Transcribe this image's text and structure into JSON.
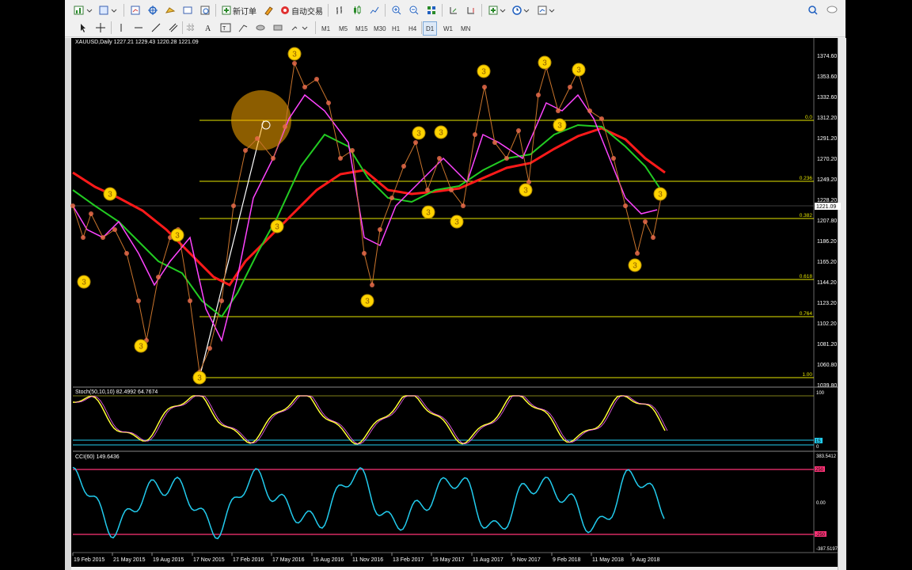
{
  "toolbar": {
    "new_order": "新订单",
    "auto_trading": "自动交易",
    "timeframes": [
      "M1",
      "M5",
      "M15",
      "M30",
      "H1",
      "H4",
      "D1",
      "W1",
      "MN"
    ],
    "active_timeframe": "D1"
  },
  "chart": {
    "symbol_info": "XAUUSD,Daily  1227.21 1229.43 1220.28 1221.09",
    "current_price": "1221.09",
    "price_ticks": [
      "1374.60",
      "1353.60",
      "1332.60",
      "1312.20",
      "1291.20",
      "1270.20",
      "1249.20",
      "1228.20",
      "1207.80",
      "1186.20",
      "1165.20",
      "1144.20",
      "1123.20",
      "1102.20",
      "1081.20",
      "1060.80",
      "1039.80"
    ],
    "fib_levels": [
      {
        "label": "0.0"
      },
      {
        "label": "0.236"
      },
      {
        "label": "0.382"
      },
      {
        "label": "0.618"
      },
      {
        "label": "0.764"
      },
      {
        "label": "1.00"
      }
    ],
    "wave_marker": "3",
    "colors": {
      "fib": "#e6e600",
      "ma_red": "#ff1a1a",
      "ma_green": "#22cc22",
      "ma_magenta": "#ff44ff",
      "marker": "#ffd400",
      "stoch": "#ffff33",
      "cci": "#22ccee",
      "cci_level": "#ff3377"
    }
  },
  "stochastic": {
    "title": "Stoch(50,10,10) 82.4992 64.7674",
    "ticks": [
      "100",
      "15",
      "0"
    ]
  },
  "cci": {
    "title": "CCI(60) 149.6436",
    "ticks": [
      "383.5412",
      "250",
      "0.00",
      "-250",
      "-387.5197"
    ]
  },
  "dates": [
    "19 Feb 2015",
    "21 May 2015",
    "19 Aug 2015",
    "17 Nov 2015",
    "17 Feb 2016",
    "17 May 2016",
    "15 Aug 2016",
    "11 Nov 2016",
    "13 Feb 2017",
    "15 May 2017",
    "11 Aug 2017",
    "9 Nov 2017",
    "9 Feb 2018",
    "11 May 2018",
    "9 Aug 2018"
  ]
}
